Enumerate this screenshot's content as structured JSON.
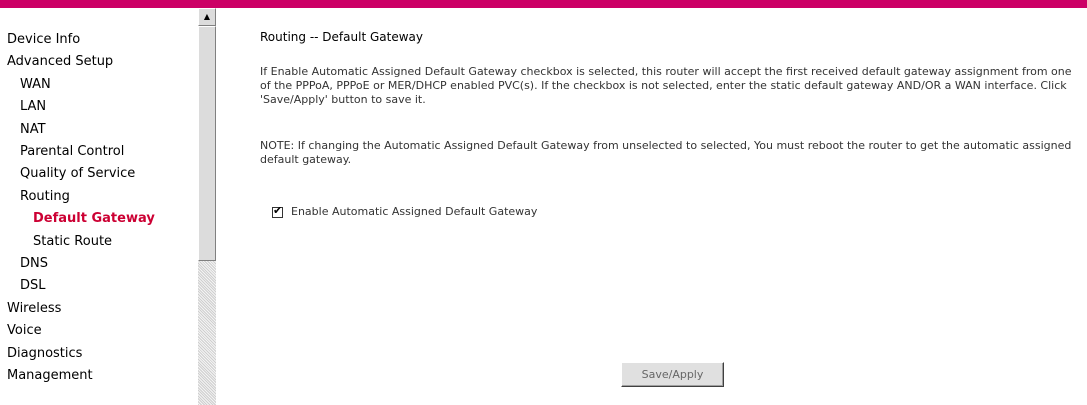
{
  "colors": {
    "brand": "#cc0066",
    "active_nav": "#cc0033"
  },
  "sidebar": {
    "items": [
      {
        "label": "Device Info"
      },
      {
        "label": "Advanced Setup"
      },
      {
        "label": "WAN"
      },
      {
        "label": "LAN"
      },
      {
        "label": "NAT"
      },
      {
        "label": "Parental Control"
      },
      {
        "label": "Quality of Service"
      },
      {
        "label": "Routing"
      },
      {
        "label": "Default Gateway"
      },
      {
        "label": "Static Route"
      },
      {
        "label": "DNS"
      },
      {
        "label": "DSL"
      },
      {
        "label": "Wireless"
      },
      {
        "label": "Voice"
      },
      {
        "label": "Diagnostics"
      },
      {
        "label": "Management"
      }
    ]
  },
  "scrollbar": {
    "up_arrow_icon": "triangle-up-icon",
    "up_arrow_glyph": "▲"
  },
  "main": {
    "title": "Routing -- Default Gateway",
    "description": "If Enable Automatic Assigned Default Gateway checkbox is selected, this router will accept the first received default gateway assignment from one of the PPPoA, PPPoE or MER/DHCP enabled PVC(s). If the checkbox is not selected, enter the static default gateway AND/OR a WAN interface. Click 'Save/Apply' button to save it.",
    "note": "NOTE: If changing the Automatic Assigned Default Gateway from unselected to selected, You must reboot the router to get the automatic assigned default gateway.",
    "checkbox_label": "Enable Automatic Assigned Default Gateway",
    "checkbox_checked": true,
    "checkbox_mark": "✔",
    "save_label": "Save/Apply"
  }
}
